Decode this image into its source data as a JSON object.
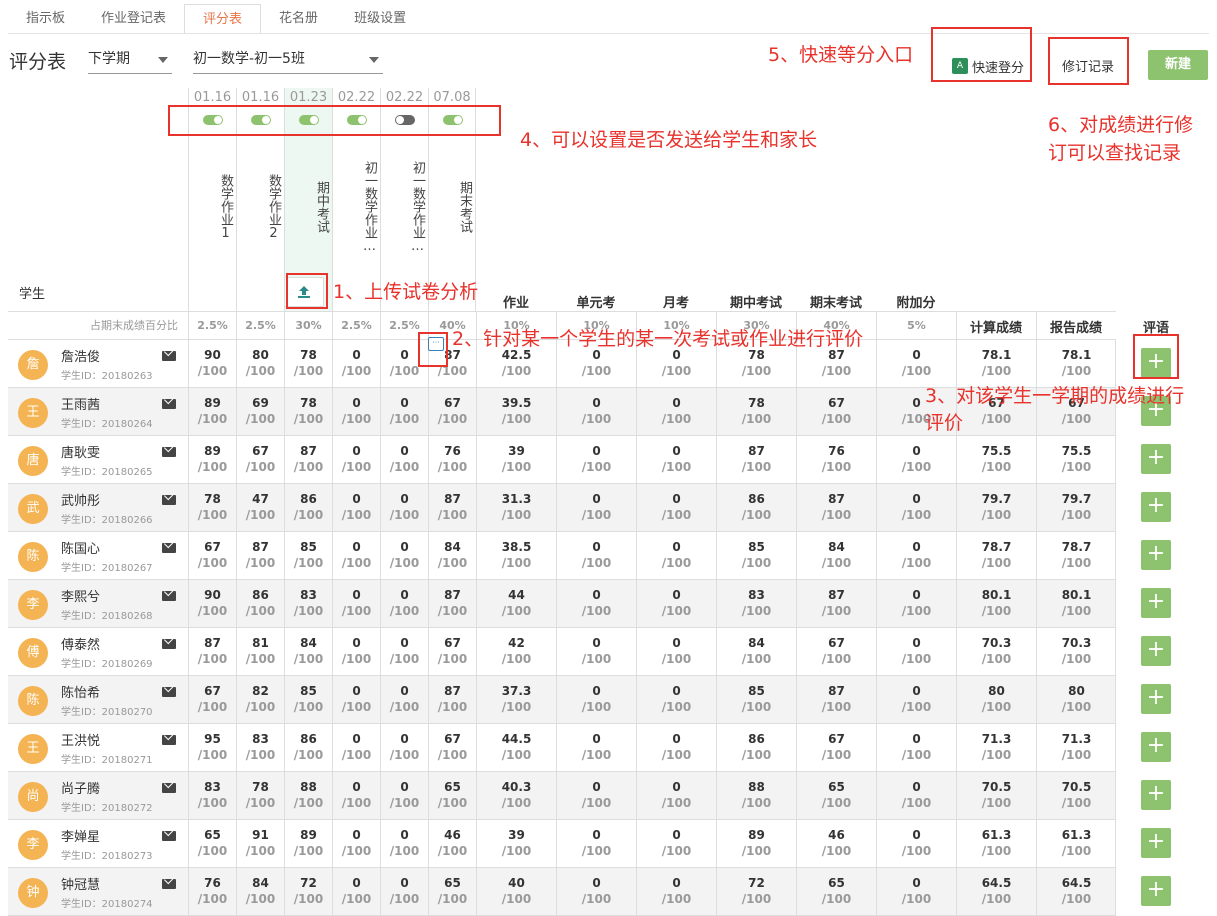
{
  "tabs": [
    "指示板",
    "作业登记表",
    "评分表",
    "花名册",
    "班级设置"
  ],
  "active_tab": 2,
  "toolbar": {
    "title": "评分表",
    "term": "下学期",
    "class": "初一数学-初一5班",
    "quick_grade": "快速登分",
    "quick_icon": "A",
    "revision_log": "修订记录",
    "new_button": "新建"
  },
  "assignments": [
    {
      "date": "01.16",
      "name": "数学作业1",
      "toggle": "on"
    },
    {
      "date": "01.16",
      "name": "数学作业2",
      "toggle": "on"
    },
    {
      "date": "01.23",
      "name": "期中考试",
      "toggle": "on"
    },
    {
      "date": "02.22",
      "name": "初一数学作业…",
      "toggle": "on"
    },
    {
      "date": "02.22",
      "name": "初一数学作业…",
      "toggle": "off"
    },
    {
      "date": "07.08",
      "name": "期末考试",
      "toggle": "on"
    }
  ],
  "student_header": "学生",
  "category_headers": [
    "作业",
    "单元考",
    "月考",
    "期中考试",
    "期末考试",
    "附加分"
  ],
  "result_headers": [
    "计算成绩",
    "报告成绩"
  ],
  "comment_header": "评语",
  "percent_label": "占期末成绩百分比",
  "percentages": [
    "2.5%",
    "2.5%",
    "30%",
    "2.5%",
    "2.5%",
    "40%",
    "10%",
    "10%",
    "10%",
    "30%",
    "40%",
    "5%"
  ],
  "max_score": "/100",
  "id_prefix": "学生ID：",
  "students": [
    {
      "avatar": "詹",
      "name": "詹浩俊",
      "id": "20180263",
      "scores": [
        "90",
        "80",
        "78",
        "0",
        "0",
        "87",
        "42.5",
        "0",
        "0",
        "78",
        "87",
        "0"
      ],
      "calc": "78.1",
      "report": "78.1"
    },
    {
      "avatar": "王",
      "name": "王雨茜",
      "id": "20180264",
      "scores": [
        "89",
        "69",
        "78",
        "0",
        "0",
        "67",
        "39.5",
        "0",
        "0",
        "78",
        "67",
        "0"
      ],
      "calc": "67",
      "report": "67"
    },
    {
      "avatar": "唐",
      "name": "唐耿雯",
      "id": "20180265",
      "scores": [
        "89",
        "67",
        "87",
        "0",
        "0",
        "76",
        "39",
        "0",
        "0",
        "87",
        "76",
        "0"
      ],
      "calc": "75.5",
      "report": "75.5"
    },
    {
      "avatar": "武",
      "name": "武帅彤",
      "id": "20180266",
      "scores": [
        "78",
        "47",
        "86",
        "0",
        "0",
        "87",
        "31.3",
        "0",
        "0",
        "86",
        "87",
        "0"
      ],
      "calc": "79.7",
      "report": "79.7"
    },
    {
      "avatar": "陈",
      "name": "陈国心",
      "id": "20180267",
      "scores": [
        "67",
        "87",
        "85",
        "0",
        "0",
        "84",
        "38.5",
        "0",
        "0",
        "85",
        "84",
        "0"
      ],
      "calc": "78.7",
      "report": "78.7"
    },
    {
      "avatar": "李",
      "name": "李熙兮",
      "id": "20180268",
      "scores": [
        "90",
        "86",
        "83",
        "0",
        "0",
        "87",
        "44",
        "0",
        "0",
        "83",
        "87",
        "0"
      ],
      "calc": "80.1",
      "report": "80.1"
    },
    {
      "avatar": "傅",
      "name": "傅泰然",
      "id": "20180269",
      "scores": [
        "87",
        "81",
        "84",
        "0",
        "0",
        "67",
        "42",
        "0",
        "0",
        "84",
        "67",
        "0"
      ],
      "calc": "70.3",
      "report": "70.3"
    },
    {
      "avatar": "陈",
      "name": "陈怡希",
      "id": "20180270",
      "scores": [
        "67",
        "82",
        "85",
        "0",
        "0",
        "87",
        "37.3",
        "0",
        "0",
        "85",
        "87",
        "0"
      ],
      "calc": "80",
      "report": "80"
    },
    {
      "avatar": "王",
      "name": "王洪悦",
      "id": "20180271",
      "scores": [
        "95",
        "83",
        "86",
        "0",
        "0",
        "67",
        "44.5",
        "0",
        "0",
        "86",
        "67",
        "0"
      ],
      "calc": "71.3",
      "report": "71.3"
    },
    {
      "avatar": "尚",
      "name": "尚子腾",
      "id": "20180272",
      "scores": [
        "83",
        "78",
        "88",
        "0",
        "0",
        "65",
        "40.3",
        "0",
        "0",
        "88",
        "65",
        "0"
      ],
      "calc": "70.5",
      "report": "70.5"
    },
    {
      "avatar": "李",
      "name": "李婵星",
      "id": "20180273",
      "scores": [
        "65",
        "91",
        "89",
        "0",
        "0",
        "46",
        "39",
        "0",
        "0",
        "89",
        "46",
        "0"
      ],
      "calc": "61.3",
      "report": "61.3"
    },
    {
      "avatar": "钟",
      "name": "钟冠慧",
      "id": "20180274",
      "scores": [
        "76",
        "84",
        "72",
        "0",
        "0",
        "65",
        "40",
        "0",
        "0",
        "72",
        "65",
        "0"
      ],
      "calc": "64.5",
      "report": "64.5"
    }
  ],
  "annotations": {
    "a1": "1、上传试卷分析",
    "a2": "2、针对某一个学生的某一次考试或作业进行评价",
    "a3_line1": "3、对该学生一学期的成绩进行",
    "a3_line2": "评价",
    "a4": "4、可以设置是否发送给学生和家长",
    "a5": "5、快速等分入口",
    "a6_line1": "6、对成绩进行修",
    "a6_line2": "订可以查找记录"
  },
  "colors": {
    "accent": "#e8754a",
    "green": "#8dc26f",
    "annotation": "#e8322c",
    "avatar": "#f5b453"
  }
}
